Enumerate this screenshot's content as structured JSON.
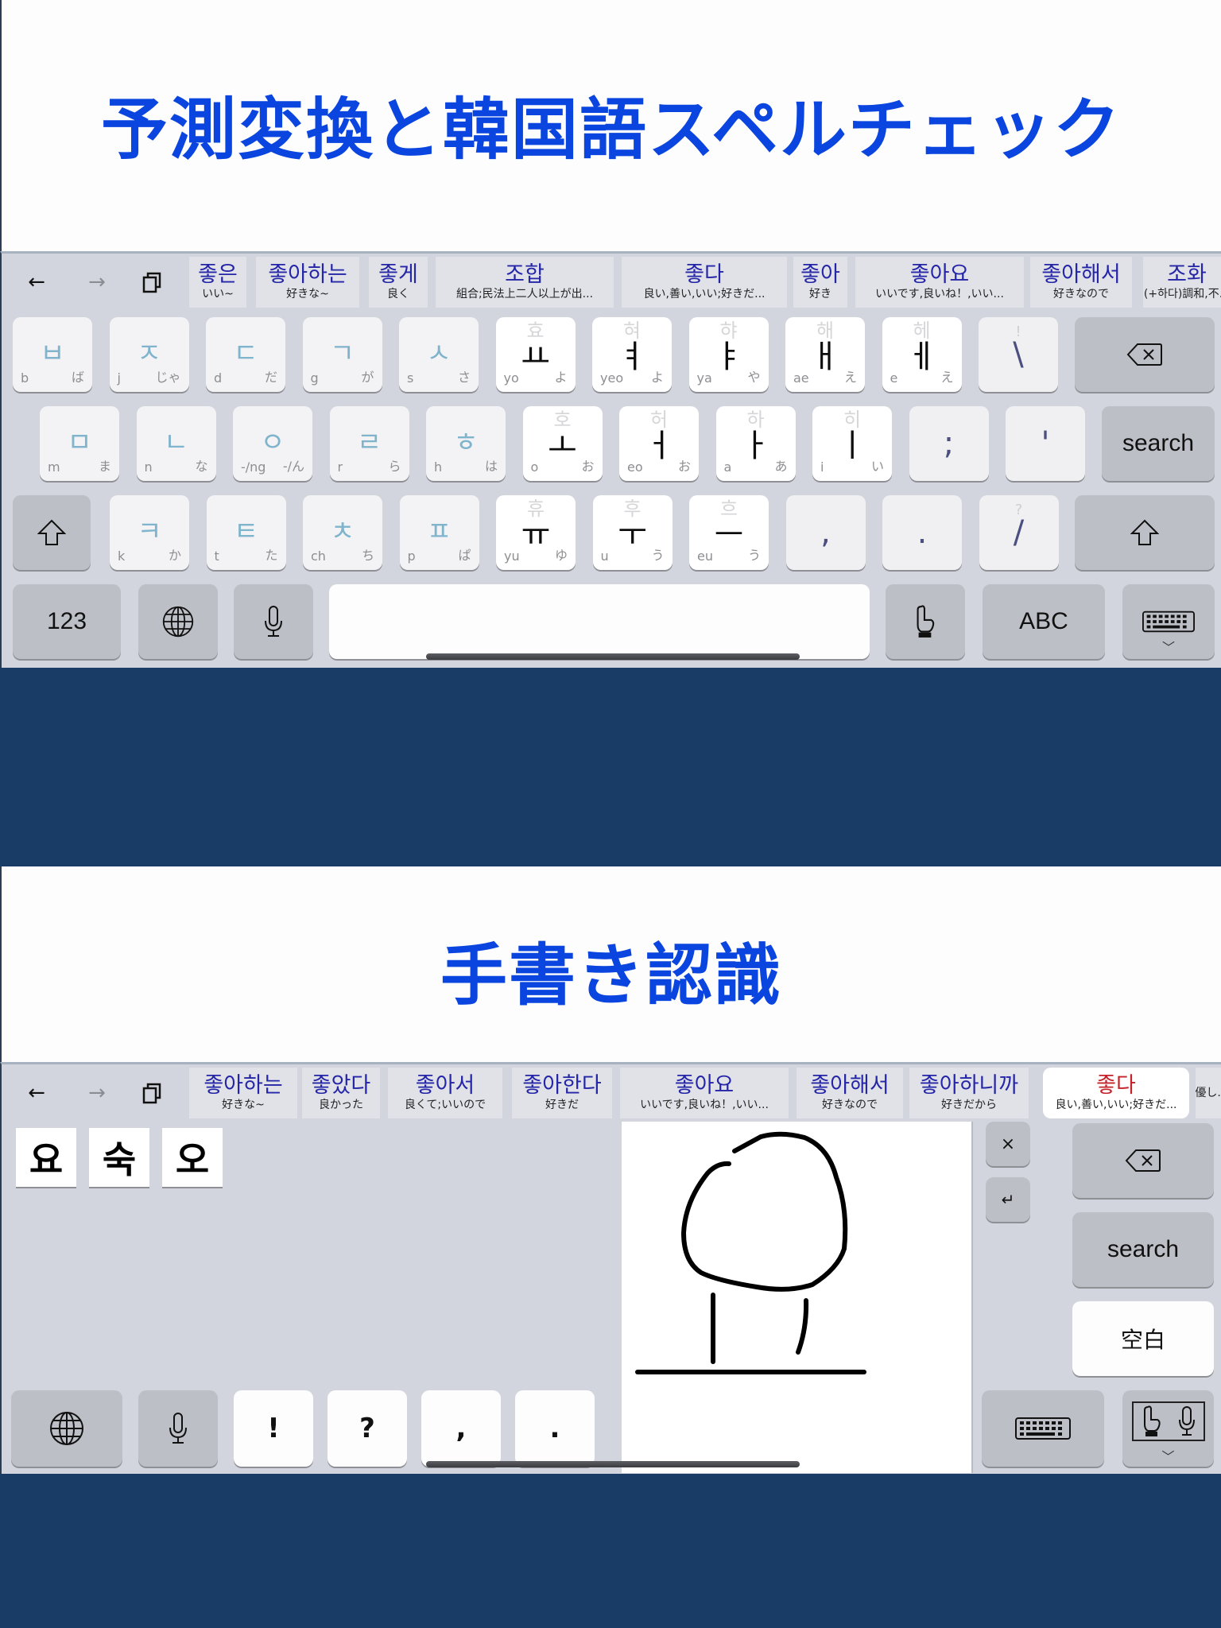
{
  "section1": {
    "title": "予測変換と韓国語スペルチェック",
    "nav": {
      "back_icon": "arrow-left-icon",
      "forward_icon": "arrow-right-icon",
      "copy_icon": "copy-icon"
    },
    "candidates": [
      {
        "word": "좋은",
        "meaning": "いい~"
      },
      {
        "word": "좋아하는",
        "meaning": "好きな~"
      },
      {
        "word": "좋게",
        "meaning": "良く"
      },
      {
        "word": "조합",
        "meaning": "組合;民法上二人以上が出..."
      },
      {
        "word": "좋다",
        "meaning": "良い,善い,いい;好きだ..."
      },
      {
        "word": "좋아",
        "meaning": "好き"
      },
      {
        "word": "좋아요",
        "meaning": "いいです,良いね！,いい..."
      },
      {
        "word": "좋아해서",
        "meaning": "好きなので"
      },
      {
        "word": "조화",
        "meaning": "(+하다)調和,不..."
      }
    ],
    "rows": [
      [
        {
          "type": "cons",
          "jamo": "ㅂ",
          "rom": "b",
          "kana": "ば"
        },
        {
          "type": "cons",
          "jamo": "ㅈ",
          "rom": "j",
          "kana": "じゃ"
        },
        {
          "type": "cons",
          "jamo": "ㄷ",
          "rom": "d",
          "kana": "だ"
        },
        {
          "type": "cons",
          "jamo": "ㄱ",
          "rom": "g",
          "kana": "が"
        },
        {
          "type": "cons",
          "jamo": "ㅅ",
          "rom": "s",
          "kana": "さ"
        },
        {
          "type": "vow",
          "jamo": "ㅛ",
          "ghost": "효",
          "rom": "yo",
          "kana": "よ"
        },
        {
          "type": "vow",
          "jamo": "ㅕ",
          "ghost": "혀",
          "rom": "yeo",
          "kana": "よ"
        },
        {
          "type": "vow",
          "jamo": "ㅑ",
          "ghost": "햐",
          "rom": "ya",
          "kana": "や"
        },
        {
          "type": "vow",
          "jamo": "ㅐ",
          "ghost": "해",
          "rom": "ae",
          "kana": "え"
        },
        {
          "type": "vow",
          "jamo": "ㅔ",
          "ghost": "헤",
          "rom": "e",
          "kana": "え"
        },
        {
          "type": "punc",
          "char": "\\",
          "ghost": "!"
        }
      ],
      [
        {
          "type": "cons",
          "jamo": "ㅁ",
          "rom": "m",
          "kana": "ま"
        },
        {
          "type": "cons",
          "jamo": "ㄴ",
          "rom": "n",
          "kana": "な"
        },
        {
          "type": "cons",
          "jamo": "ㅇ",
          "rom": "-/ng",
          "kana": "-/ん"
        },
        {
          "type": "cons",
          "jamo": "ㄹ",
          "rom": "r",
          "kana": "ら"
        },
        {
          "type": "cons",
          "jamo": "ㅎ",
          "rom": "h",
          "kana": "は"
        },
        {
          "type": "vow",
          "jamo": "ㅗ",
          "ghost": "호",
          "rom": "o",
          "kana": "お"
        },
        {
          "type": "vow",
          "jamo": "ㅓ",
          "ghost": "허",
          "rom": "eo",
          "kana": "お"
        },
        {
          "type": "vow",
          "jamo": "ㅏ",
          "ghost": "하",
          "rom": "a",
          "kana": "あ"
        },
        {
          "type": "vow",
          "jamo": "ㅣ",
          "ghost": "히",
          "rom": "i",
          "kana": "い"
        },
        {
          "type": "punc",
          "char": ";",
          "ghost": ""
        },
        {
          "type": "punc",
          "char": "'",
          "ghost": ""
        }
      ],
      [
        {
          "type": "cons",
          "jamo": "ㅋ",
          "rom": "k",
          "kana": "か"
        },
        {
          "type": "cons",
          "jamo": "ㅌ",
          "rom": "t",
          "kana": "た"
        },
        {
          "type": "cons",
          "jamo": "ㅊ",
          "rom": "ch",
          "kana": "ち"
        },
        {
          "type": "cons",
          "jamo": "ㅍ",
          "rom": "p",
          "kana": "ぱ"
        },
        {
          "type": "vow",
          "jamo": "ㅠ",
          "ghost": "휴",
          "rom": "yu",
          "kana": "ゆ"
        },
        {
          "type": "vow",
          "jamo": "ㅜ",
          "ghost": "후",
          "rom": "u",
          "kana": "う"
        },
        {
          "type": "vow",
          "jamo": "ㅡ",
          "ghost": "흐",
          "rom": "eu",
          "kana": "う"
        },
        {
          "type": "punc",
          "char": ",",
          "ghost": ""
        },
        {
          "type": "punc",
          "char": ".",
          "ghost": ""
        },
        {
          "type": "punc",
          "char": "/",
          "ghost": "?"
        }
      ]
    ],
    "search_label": "search",
    "numbers_label": "123",
    "abc_label": "ABC"
  },
  "section2": {
    "title": "手書き認識",
    "candidates": [
      {
        "word": "좋아하는",
        "meaning": "好きな~"
      },
      {
        "word": "좋았다",
        "meaning": "良かった"
      },
      {
        "word": "좋아서",
        "meaning": "良くて;いいので"
      },
      {
        "word": "좋아한다",
        "meaning": "好きだ"
      },
      {
        "word": "좋아요",
        "meaning": "いいです,良いね！,いい..."
      },
      {
        "word": "좋아해서",
        "meaning": "好きなので"
      },
      {
        "word": "좋아하니까",
        "meaning": "好きだから"
      },
      {
        "word": "좋다",
        "meaning": "良い,善い,いい;好きだ...",
        "selected": true
      },
      {
        "word": "",
        "meaning": "優し..."
      }
    ],
    "recognized": [
      "요",
      "숙",
      "오"
    ],
    "punct_keys": [
      "!",
      "?",
      ",",
      "."
    ],
    "clear_label": "×",
    "enter_label": "↵",
    "search_label": "search",
    "space_label": "空白"
  }
}
